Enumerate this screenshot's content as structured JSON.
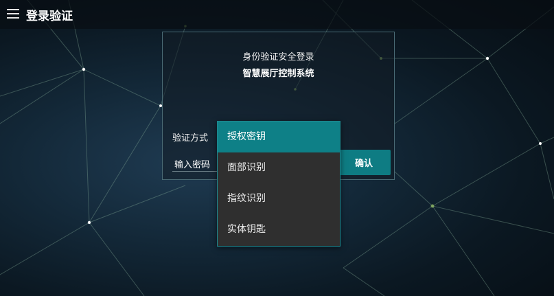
{
  "header": {
    "title": "登录验证",
    "menu_icon": "hamburger-menu-icon"
  },
  "card": {
    "subtitle": "身份验证安全登录",
    "system_name": "智慧展厅控制系统",
    "method_label": "验证方式",
    "password_label": "输入密码",
    "confirm_label": "确认"
  },
  "dropdown": {
    "selected_index": 0,
    "options": [
      "授权密钥",
      "面部识别",
      "指纹识别",
      "实体钥匙"
    ]
  },
  "colors": {
    "accent": "#0e7c83",
    "dropdown_bg": "#2f2f2f",
    "border": "#1d8a91"
  }
}
